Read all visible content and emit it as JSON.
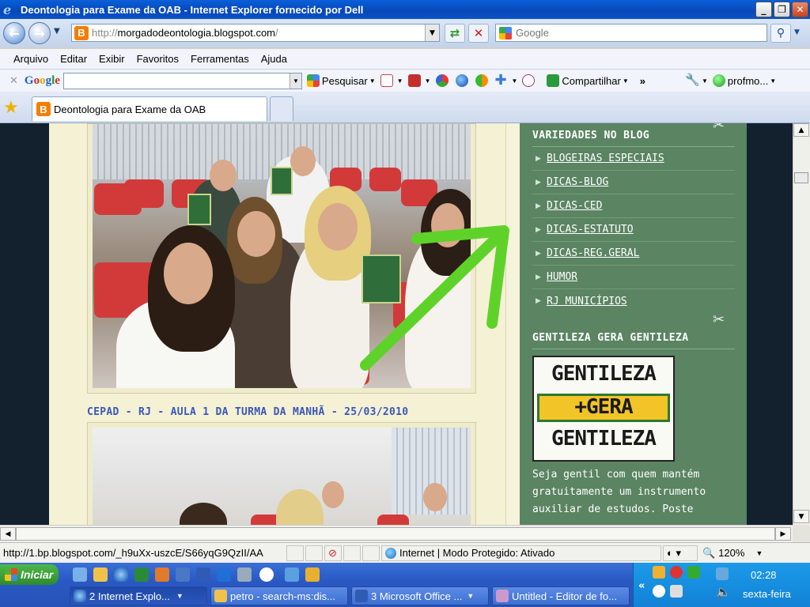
{
  "window": {
    "title": "Deontologia para Exame da OAB - Internet Explorer fornecido por Dell",
    "buttons": [
      "_",
      "❐",
      "✕"
    ]
  },
  "address": {
    "url_prefix": "http://",
    "url_domain": "morgadodeontologia.blogspot.com",
    "url_suffix": "/",
    "search_placeholder": "Google"
  },
  "menu": {
    "items": [
      "Arquivo",
      "Editar",
      "Exibir",
      "Favoritos",
      "Ferramentas",
      "Ajuda"
    ]
  },
  "google_toolbar": {
    "logo": "Google",
    "search_label": "Pesquisar",
    "share_label": "Compartilhar",
    "profile_label": "profmo..."
  },
  "tabs": [
    {
      "title": "Deontologia para Exame da OAB"
    }
  ],
  "post": {
    "title": "CEPAD - RJ - AULA 1 DA TURMA DA MANHÃ - 25/03/2010"
  },
  "sidebar": {
    "section1_title": "VARIEDADES NO BLOG",
    "labels": [
      "BLOGEIRAS ESPECIAIS",
      "DICAS-BLOG",
      "DICAS-CED",
      "DICAS-ESTATUTO",
      "DICAS-REG.GERAL",
      "HUMOR",
      "RJ MUNICÍPIOS"
    ],
    "section2_title": "GENTILEZA GERA GENTILEZA",
    "image_lines": [
      "GENTILEZA",
      "+GERA",
      "GENTILEZA"
    ],
    "text_lines": [
      "Seja gentil com quem mantém",
      "gratuitamente um instrumento",
      "auxiliar de estudos. Poste"
    ]
  },
  "status": {
    "link": "http://1.bp.blogspot.com/_h9uXx-uszcE/S66yqG9QzII/AA",
    "zone": "Internet | Modo Protegido: Ativado",
    "zoom": "120%"
  },
  "taskbar": {
    "start_label": "Iniciar",
    "tasks": [
      "2 Internet Explo...",
      "petro - search-ms:dis...",
      "3 Microsoft Office ...",
      "Untitled - Editor de fo..."
    ],
    "clock": "02:28",
    "day": "sexta-feira"
  },
  "colors": {
    "sidebar_bg": "#5a8462",
    "post_title": "#3a57b8",
    "arrow": "#5fd22a"
  },
  "icons": [
    "ie-logo-icon",
    "back-icon",
    "forward-icon",
    "refresh-icon",
    "stop-icon",
    "search-icon",
    "favorites-star-icon",
    "blogger-icon",
    "wrench-icon",
    "globe-icon",
    "windows-logo-icon"
  ]
}
